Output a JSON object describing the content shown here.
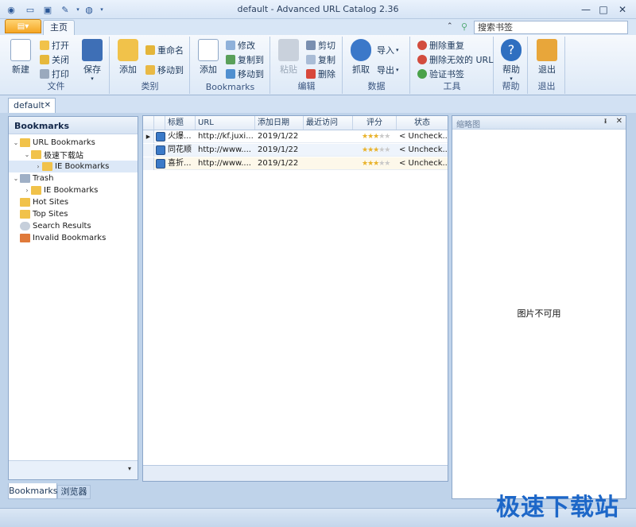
{
  "window": {
    "title": "default - Advanced URL Catalog 2.36",
    "controls": [
      "—",
      "□",
      "✕"
    ]
  },
  "ribbon": {
    "tab_home": "主页",
    "search_placeholder": "搜索书签",
    "groups": {
      "file": {
        "label": "文件",
        "new": "新建",
        "open": "打开",
        "close": "关闭",
        "print": "打印",
        "save": "保存"
      },
      "category": {
        "label": "类别",
        "add": "添加",
        "rename": "重命名",
        "move_to": "移动到"
      },
      "bookmarks": {
        "label": "Bookmarks",
        "add": "添加",
        "edit": "修改",
        "copy_to": "复制到",
        "move_to": "移动到"
      },
      "edit": {
        "label": "编辑",
        "paste": "粘贴",
        "cut": "剪切",
        "copy": "复制",
        "delete": "删除"
      },
      "data": {
        "label": "数据",
        "grab": "抓取",
        "import": "导入",
        "export": "导出"
      },
      "tools": {
        "label": "工具",
        "remove_dup": "删除重复",
        "remove_invalid": "删除无效的 URL",
        "verify": "验证书签"
      },
      "help": {
        "label": "帮助",
        "help": "帮助"
      },
      "exit": {
        "label": "退出",
        "exit": "退出"
      }
    }
  },
  "doc_tab": {
    "label": "default",
    "close": "✕"
  },
  "left_panel": {
    "title": "Bookmarks",
    "tree": [
      {
        "label": "URL Bookmarks",
        "toggle": "⌄"
      },
      {
        "label": "极速下载站",
        "toggle": "⌄"
      },
      {
        "label": "IE Bookmarks",
        "toggle": "›"
      },
      {
        "label": "Trash",
        "toggle": "⌄"
      },
      {
        "label": "IE Bookmarks",
        "toggle": "›"
      },
      {
        "label": "Hot Sites",
        "toggle": ""
      },
      {
        "label": "Top Sites",
        "toggle": ""
      },
      {
        "label": "Search Results",
        "toggle": ""
      },
      {
        "label": "Invalid Bookmarks",
        "toggle": ""
      }
    ],
    "footer_arrow": "▾"
  },
  "bottom_tabs": {
    "bookmarks": "Bookmarks",
    "browser": "浏览器"
  },
  "grid": {
    "columns": [
      "标题",
      "URL",
      "添加日期",
      "最近访问",
      "评分",
      "状态"
    ],
    "rows": [
      {
        "title": "火爆...",
        "url": "http://kf.juxi...",
        "added": "2019/1/22",
        "visited": "",
        "rating": 3,
        "status": "< Uncheck..."
      },
      {
        "title": "同花顺",
        "url": "http://www....",
        "added": "2019/1/22",
        "visited": "",
        "rating": 3,
        "status": "< Uncheck..."
      },
      {
        "title": "喜折...",
        "url": "http://www....",
        "added": "2019/1/22",
        "visited": "",
        "rating": 3,
        "status": "< Uncheck..."
      }
    ]
  },
  "right_panel": {
    "title": "缩略图",
    "pin": "ᵻ",
    "close": "✕",
    "no_image": "图片不可用"
  },
  "watermark": "极速下载站",
  "colors": {
    "accent": "#1d67c8",
    "app_button": "#f5a623",
    "frame": "#bfd3ea"
  }
}
